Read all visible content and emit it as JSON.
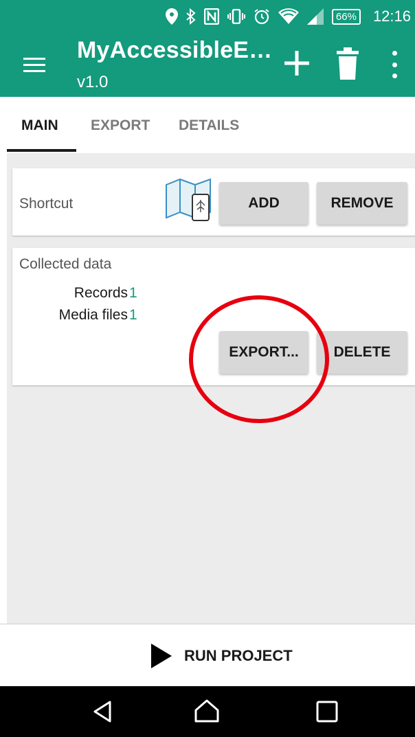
{
  "status_bar": {
    "battery": "66%",
    "time": "12:16",
    "icons": [
      "location-icon",
      "bluetooth-icon",
      "nfc-icon",
      "vibrate-icon",
      "alarm-icon",
      "wifi-icon",
      "signal-icon",
      "battery-icon"
    ]
  },
  "app_bar": {
    "title": "MyAccessibleE…",
    "subtitle": "v1.0",
    "actions": [
      "menu-icon",
      "plus-icon",
      "trash-icon",
      "overflow-icon"
    ]
  },
  "tabs": [
    {
      "label": "MAIN",
      "active": true
    },
    {
      "label": "EXPORT",
      "active": false
    },
    {
      "label": "DETAILS",
      "active": false
    }
  ],
  "shortcut_card": {
    "label": "Shortcut",
    "add_label": "ADD",
    "remove_label": "REMOVE"
  },
  "data_card": {
    "title": "Collected data",
    "records_label": "Records",
    "records_value": "1",
    "media_label": "Media files",
    "media_value": "1",
    "export_label": "EXPORT...",
    "delete_label": "DELETE"
  },
  "run": {
    "label": "RUN PROJECT"
  },
  "colors": {
    "primary": "#149a7d",
    "annotation": "#e6000f",
    "background": "#ececec"
  }
}
